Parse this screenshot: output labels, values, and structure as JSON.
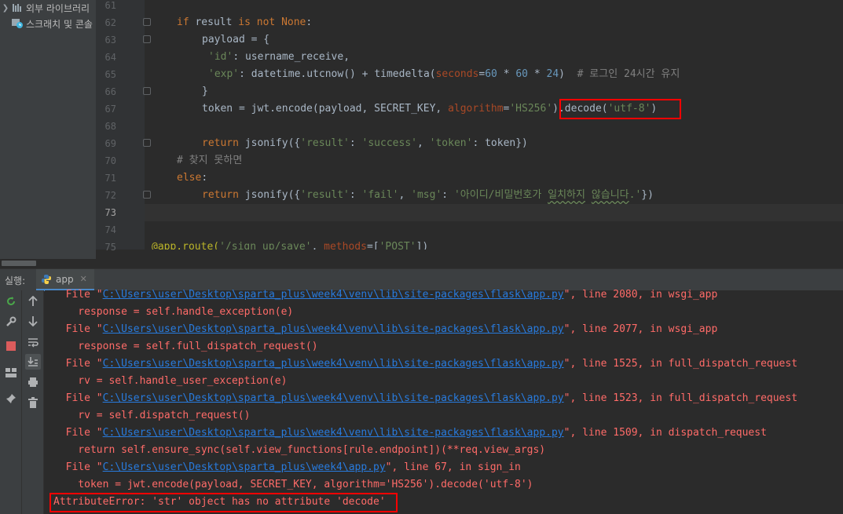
{
  "project_tree": {
    "items": [
      {
        "label": "외부 라이브러리",
        "icon": "library-icon"
      },
      {
        "label": "스크래치 및 콘솔",
        "icon": "scratch-icon"
      }
    ]
  },
  "editor": {
    "line_numbers": [
      "61",
      "62",
      "63",
      "64",
      "65",
      "66",
      "67",
      "68",
      "69",
      "70",
      "71",
      "72",
      "73",
      "74",
      "75"
    ],
    "current_line": "73",
    "lines": {
      "l62": {
        "kw1": "if",
        "t1": " result ",
        "kw2": "is not None",
        "t2": ":"
      },
      "l63": {
        "t1": "payload = {"
      },
      "l64": {
        "s1": "'id'",
        "t1": ": username_receive,"
      },
      "l65": {
        "s1": "'exp'",
        "t1": ": datetime.utcnow() + timedelta(",
        "p1": "seconds",
        "t2": "=",
        "n1": "60",
        "t3": " * ",
        "n2": "60",
        "t4": " * ",
        "n3": "24",
        "t5": ")  ",
        "c1": "# 로그인 24시간 유지"
      },
      "l66": {
        "t1": "}"
      },
      "l67": {
        "t1": "token = jwt.encode(payload, SECRET_KEY, ",
        "p1": "algorithm",
        "t2": "=",
        "s1": "'HS256'",
        "t3": ").decode(",
        "s2": "'utf-8'",
        "t4": ")"
      },
      "l69": {
        "kw1": "return",
        "t1": " jsonify({",
        "s1": "'result'",
        "t2": ": ",
        "s2": "'success'",
        "t3": ", ",
        "s3": "'token'",
        "t4": ": token})"
      },
      "l70": {
        "c1": "# 찾지 못하면"
      },
      "l71": {
        "kw1": "else",
        "t1": ":"
      },
      "l72": {
        "kw1": "return",
        "t1": " jsonify({",
        "s1": "'result'",
        "t2": ": ",
        "s2": "'fail'",
        "t3": ", ",
        "s3": "'msg'",
        "t4": ": ",
        "s4a": "'아이디/비밀번호가 ",
        "s4b": "일치하지",
        "s4c": " ",
        "s4d": "않습니다",
        "s4e": ".'",
        "t5": "})"
      },
      "l75": {
        "d1": "@app.route(",
        "s1": "'/sign_up/save'",
        "t1": ", ",
        "p1": "methods",
        "t2": "=[",
        "s2": "'POST'",
        "t3": "])"
      }
    }
  },
  "run_panel": {
    "label": "실행:",
    "tab": "app",
    "console": [
      {
        "pre": "  File \"",
        "path": "C:\\Users\\user\\Desktop\\sparta_plus\\week4\\venv\\lib\\site-packages\\flask\\app.py",
        "post": "\", line 2080, in wsgi_app"
      },
      {
        "text": "    response = self.handle_exception(e)"
      },
      {
        "pre": "  File \"",
        "path": "C:\\Users\\user\\Desktop\\sparta_plus\\week4\\venv\\lib\\site-packages\\flask\\app.py",
        "post": "\", line 2077, in wsgi_app"
      },
      {
        "text": "    response = self.full_dispatch_request()"
      },
      {
        "pre": "  File \"",
        "path": "C:\\Users\\user\\Desktop\\sparta_plus\\week4\\venv\\lib\\site-packages\\flask\\app.py",
        "post": "\", line 1525, in full_dispatch_request"
      },
      {
        "text": "    rv = self.handle_user_exception(e)"
      },
      {
        "pre": "  File \"",
        "path": "C:\\Users\\user\\Desktop\\sparta_plus\\week4\\venv\\lib\\site-packages\\flask\\app.py",
        "post": "\", line 1523, in full_dispatch_request"
      },
      {
        "text": "    rv = self.dispatch_request()"
      },
      {
        "pre": "  File \"",
        "path": "C:\\Users\\user\\Desktop\\sparta_plus\\week4\\venv\\lib\\site-packages\\flask\\app.py",
        "post": "\", line 1509, in dispatch_request"
      },
      {
        "text": "    return self.ensure_sync(self.view_functions[rule.endpoint])(**req.view_args)"
      },
      {
        "pre": "  File \"",
        "path": "C:\\Users\\user\\Desktop\\sparta_plus\\week4\\app.py",
        "post": "\", line 67, in sign_in"
      },
      {
        "text": "    token = jwt.encode(payload, SECRET_KEY, algorithm='HS256').decode('utf-8')"
      },
      {
        "text": "AttributeError: 'str' object has no attribute 'decode'"
      }
    ]
  },
  "colors": {
    "keyword": "#cc7832",
    "string": "#6a8759",
    "number": "#6897bb",
    "error_text": "#ff6b68",
    "link": "#287bde",
    "highlight_box": "#ff0000"
  }
}
